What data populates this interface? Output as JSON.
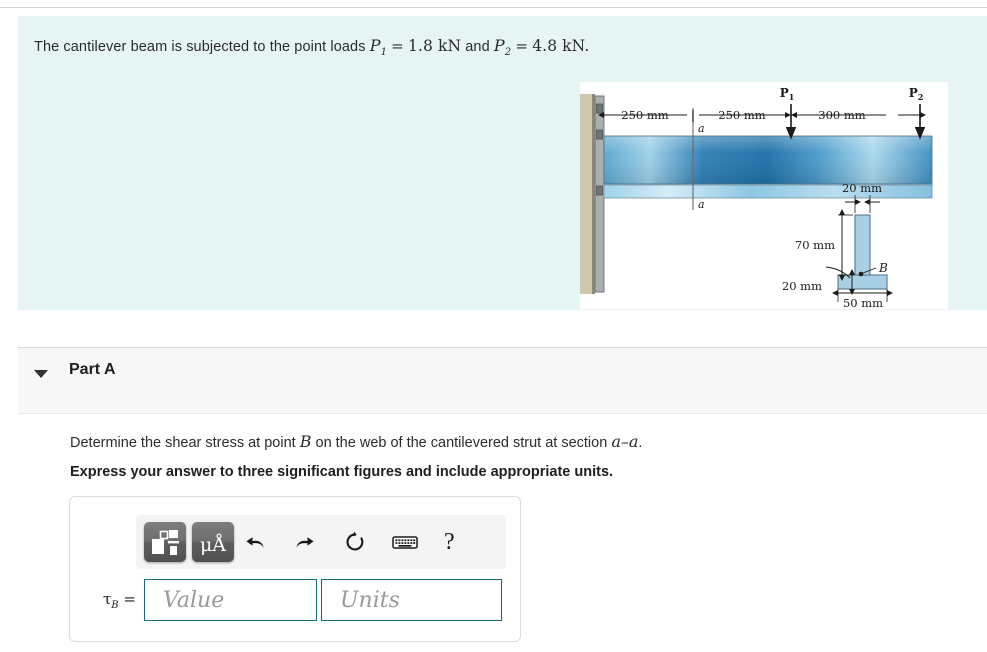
{
  "problem": {
    "text_before": "The cantilever beam is subjected to the point loads",
    "load1_symbol": "P",
    "load1_sub": "1",
    "equals": "=",
    "load1_value": "1.8 kN",
    "conjunction": "and",
    "load2_symbol": "P",
    "load2_sub": "2",
    "load2_value": "4.8 kN",
    "period": "."
  },
  "figure": {
    "dim_250_left": "250 mm",
    "dim_250_right": "250 mm",
    "dim_300": "300 mm",
    "load1_label": "P",
    "load1_sub": "1",
    "load2_label": "P",
    "load2_sub": "2",
    "section_label_top": "a",
    "section_label_bottom": "a",
    "cs_web_thickness": "20 mm",
    "cs_web_height": "70 mm",
    "cs_flange_thickness": "20 mm",
    "cs_flange_width": "50 mm",
    "point_label": "B",
    "colors": {
      "beam_dark": "#2d7fb8",
      "beam_light": "#b9dcee",
      "wall": "#cfc8ad",
      "plate": "#9aa0a0",
      "section_fill": "#a8cfe4"
    }
  },
  "part": {
    "caret": "collapse-caret",
    "title": "Part A"
  },
  "question": {
    "prompt_a": "Determine the shear stress at point",
    "prompt_var": "B",
    "prompt_b": "on the web of the cantilevered strut at section",
    "prompt_section": "a–a",
    "prompt_end": ".",
    "instruction": "Express your answer to three significant figures and include appropriate units."
  },
  "answer": {
    "toolbar": {
      "template_button": "math-template",
      "units_button": "μÅ",
      "undo": "undo",
      "redo": "redo",
      "reset": "reset",
      "keyboard": "keyboard",
      "help": "?"
    },
    "label_symbol": "τ",
    "label_sub": "B",
    "label_equals": "=",
    "value_placeholder": "Value",
    "units_placeholder": "Units"
  }
}
